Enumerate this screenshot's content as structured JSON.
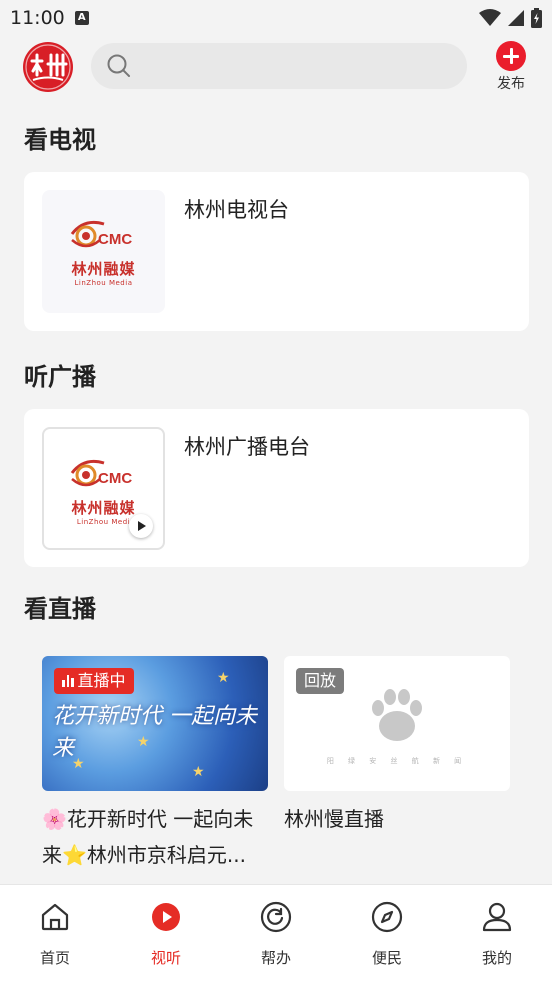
{
  "status_bar": {
    "time": "11:00",
    "notification_icon_letter": "A",
    "icons": [
      "wifi-icon",
      "signal-icon",
      "battery-icon"
    ]
  },
  "header": {
    "logo_icon": "linzhou-logo-icon",
    "search": {
      "placeholder": "",
      "icon": "search-icon"
    },
    "publish": {
      "label": "发布",
      "icon": "plus-circle-icon"
    }
  },
  "sections": {
    "tv": {
      "title": "看电视",
      "item": {
        "title": "林州电视台",
        "logo_text": "林州融媒",
        "logo_sub": "LinZhou Media",
        "logo_mark": "CMC"
      }
    },
    "radio": {
      "title": "听广播",
      "item": {
        "title": "林州广播电台",
        "logo_text": "林州融媒",
        "logo_sub": "LinZhou Medi",
        "logo_mark": "CMC"
      }
    },
    "live": {
      "title": "看直播",
      "items": [
        {
          "tag": "直播中",
          "banner_text": "花开新时代 一起向未来",
          "caption_line1": "🌸花开新时代 一起向未",
          "caption_line2": "来⭐林州市京科启元..."
        },
        {
          "tag": "回放",
          "placeholder_caption": "阳 绿 安 丝 航 新 闻",
          "caption_line1": "林州慢直播"
        }
      ]
    }
  },
  "tabbar": {
    "items": [
      {
        "label": "首页",
        "icon": "home-icon",
        "active": false
      },
      {
        "label": "视听",
        "icon": "play-circle-icon",
        "active": true
      },
      {
        "label": "帮办",
        "icon": "refresh-circle-icon",
        "active": false
      },
      {
        "label": "便民",
        "icon": "compass-icon",
        "active": false
      },
      {
        "label": "我的",
        "icon": "user-icon",
        "active": false
      }
    ]
  },
  "colors": {
    "accent": "#e52c25",
    "brand_red": "#d81e26",
    "background": "#f3f3f3",
    "card": "#ffffff"
  }
}
